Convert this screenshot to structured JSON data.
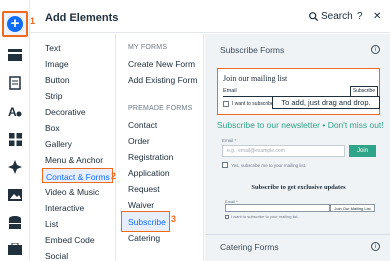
{
  "header": {
    "title": "Add Elements",
    "search_label": "Search",
    "help_label": "?",
    "close_label": "✕"
  },
  "steps": {
    "one": "1",
    "two": "2",
    "three": "3"
  },
  "categories": [
    "Text",
    "Image",
    "Button",
    "Strip",
    "Decorative",
    "Box",
    "Gallery",
    "Menu & Anchor",
    "Contact & Forms",
    "Video & Music",
    "Interactive",
    "List",
    "Embed Code",
    "Social"
  ],
  "forms": {
    "my_forms_heading": "MY FORMS",
    "create_new": "Create New Form",
    "add_existing": "Add Existing Form",
    "premade_heading": "PREMADE FORMS",
    "premade": [
      "Contact",
      "Order",
      "Registration",
      "Application",
      "Request",
      "Waiver",
      "Subscribe",
      "Catering"
    ]
  },
  "preview": {
    "subscribe_title": "Subscribe Forms",
    "catering_title": "Catering Forms",
    "info_label": "i",
    "form1": {
      "title": "Join our mailing list",
      "email_label": "Email",
      "button": "Subscribe",
      "checkbox": "I want to subscribe to your mailing list."
    },
    "tooltip": "To add, just drag and drop.",
    "form2": {
      "title": "Subscribe to our newsletter • Don't miss out!",
      "email_label": "Email *",
      "placeholder": "e.g., email@example.com",
      "button": "Join",
      "checkbox": "Yes, subscribe me to your mailing list."
    },
    "form3": {
      "title": "Subscribe to get exclusive updates",
      "email_label": "Email *",
      "button": "Join Our Mailing List",
      "checkbox": "I want to subscribe to your mailing list."
    }
  },
  "colors": {
    "accent": "#116dff",
    "highlight": "#f06a1d",
    "green": "#2fa489"
  }
}
